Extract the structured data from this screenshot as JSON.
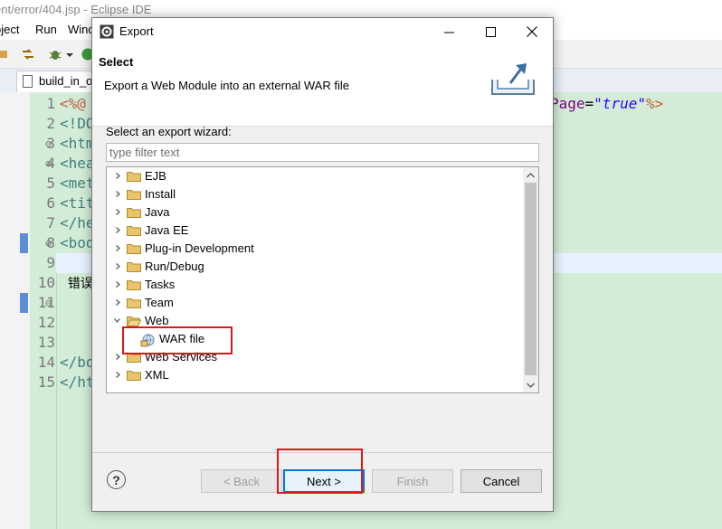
{
  "ide": {
    "title": "ent/error/404.jsp - Eclipse IDE",
    "menu": [
      "oject",
      "Run",
      "Wind"
    ],
    "editor_tab": "build_in_ob",
    "line_numbers": [
      "1",
      "2",
      "3",
      "4",
      "5",
      "6",
      "7",
      "8",
      "9",
      "10",
      "11",
      "12",
      "13",
      "14",
      "15"
    ],
    "line_markers": [
      "",
      "",
      "⊖",
      "⊖",
      "",
      "",
      "",
      "⊖",
      "",
      "",
      "⊖",
      "",
      "",
      "",
      ""
    ],
    "code_lines": [
      "<%@",
      "<!DO",
      "<htm",
      "<hea",
      "<met",
      "<tit",
      "</he",
      "<bod",
      "",
      "  错误",
      "",
      "",
      "",
      "</bo",
      "</ht"
    ],
    "line1_tail": {
      "attr": "Page",
      "eq": "=",
      "value": "\"true\"",
      "close": "%>"
    }
  },
  "dialog": {
    "window_title": "Export",
    "header_title": "Select",
    "header_description": "Export a Web Module into an external WAR file",
    "prompt": "Select an export wizard:",
    "filter_placeholder": "type filter text",
    "tree": {
      "items": [
        {
          "label": "EJB",
          "expanded": false
        },
        {
          "label": "Install",
          "expanded": false
        },
        {
          "label": "Java",
          "expanded": false
        },
        {
          "label": "Java EE",
          "expanded": false
        },
        {
          "label": "Plug-in Development",
          "expanded": false
        },
        {
          "label": "Run/Debug",
          "expanded": false
        },
        {
          "label": "Tasks",
          "expanded": false
        },
        {
          "label": "Team",
          "expanded": false
        },
        {
          "label": "Web",
          "expanded": true
        },
        {
          "label": "WAR file",
          "child": true
        },
        {
          "label": "Web Services",
          "expanded": false
        },
        {
          "label": "XML",
          "expanded": false
        }
      ]
    },
    "buttons": {
      "help": "?",
      "back": "< Back",
      "next": "Next >",
      "finish": "Finish",
      "cancel": "Cancel"
    },
    "colors": {
      "highlight": "#d9191c",
      "default_button_border": "#0078d7",
      "folder": "#e8c46a"
    }
  }
}
